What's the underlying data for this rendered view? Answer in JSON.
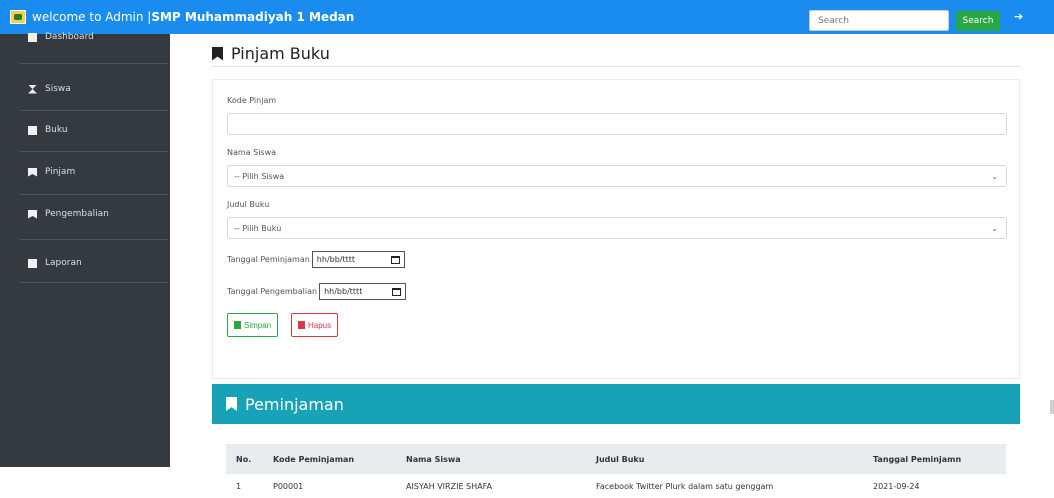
{
  "topbar": {
    "welcome": "welcome to Admin | ",
    "school": "SMP Muhammadiyah 1 Medan",
    "search_placeholder": "Search",
    "search_button": "Search"
  },
  "sidebar": {
    "items": [
      {
        "label": "Dashboard",
        "icon": "dashboard-icon"
      },
      {
        "label": "Siswa",
        "icon": "hourglass-icon"
      },
      {
        "label": "Buku",
        "icon": "book-icon"
      },
      {
        "label": "Pinjam",
        "icon": "bookmark-icon"
      },
      {
        "label": "Pengembalian",
        "icon": "bookmark-icon"
      },
      {
        "label": "Laporan",
        "icon": "file-icon"
      }
    ]
  },
  "page": {
    "title": "Pinjam Buku"
  },
  "form": {
    "kode_label": "Kode Pinjam",
    "kode_value": "",
    "nama_label": "Nama Siswa",
    "nama_selected": "-- Pilih Siswa",
    "judul_label": "Judul Buku",
    "judul_selected": "-- Pilih Buku",
    "tgl_pinjam_label": "Tanggal Peminjaman",
    "tgl_pinjam_value": "hh/bb/tttt",
    "tgl_kembali_label": "Tanggal Pengembalian",
    "tgl_kembali_value": "hh/bb/tttt",
    "save_label": "Simpan",
    "delete_label": "Hapus"
  },
  "section": {
    "title": "Peminjaman"
  },
  "table": {
    "headers": [
      "No.",
      "Kode Peminjaman",
      "Nama Siswa",
      "Judul Buku",
      "Tanggal Peminjamn"
    ],
    "rows": [
      [
        "1",
        "P00001",
        "AISYAH VIRZIE SHAFA",
        "Facebook Twitter Plurk dalam satu genggam",
        "2021-09-24"
      ]
    ]
  },
  "colors": {
    "topbar": "#1a8cf0",
    "sidebar": "#343a40",
    "section": "#17a2b8",
    "success": "#28a745",
    "danger": "#dc3545"
  }
}
